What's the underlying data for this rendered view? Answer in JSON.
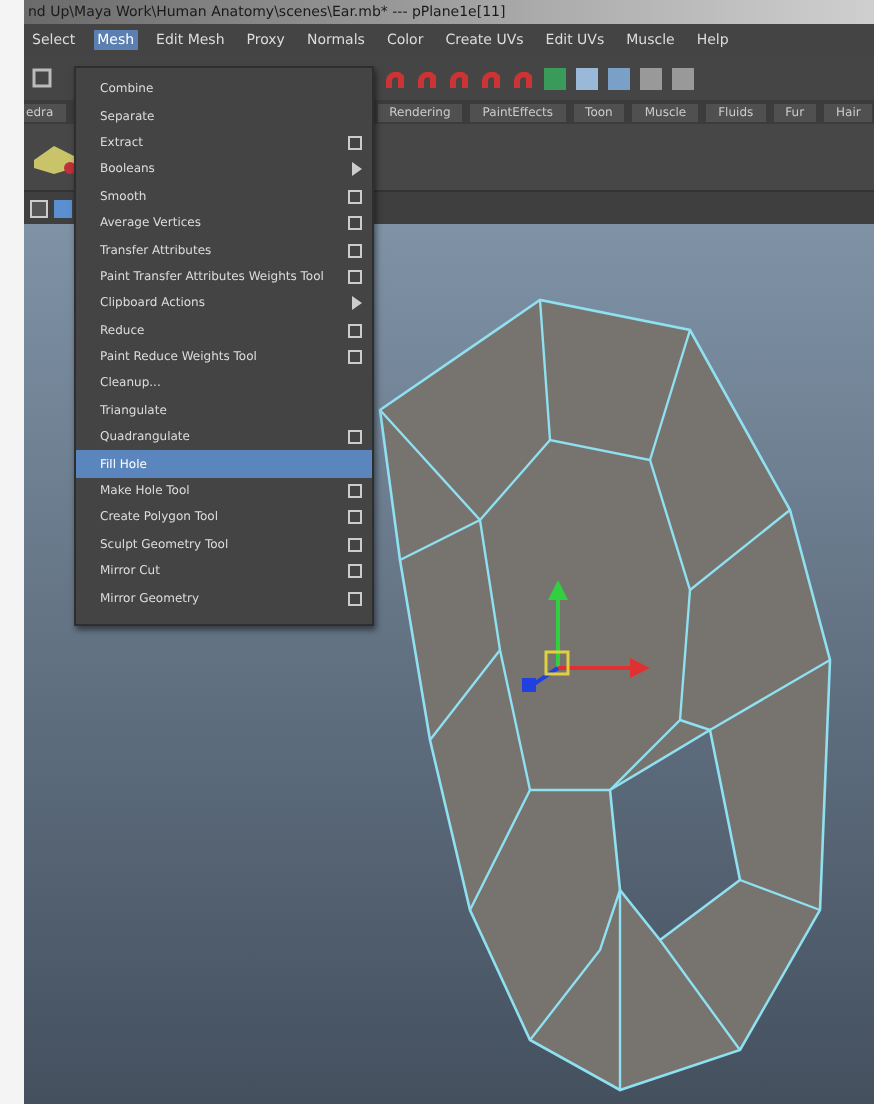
{
  "window": {
    "title": "nd Up\\Maya Work\\Human Anatomy\\scenes\\Ear.mb*  ---  pPlane1e[11]"
  },
  "menu_bar": [
    {
      "label": "Select",
      "selected": false
    },
    {
      "label": "Mesh",
      "selected": true
    },
    {
      "label": "Edit Mesh",
      "selected": false
    },
    {
      "label": "Proxy",
      "selected": false
    },
    {
      "label": "Normals",
      "selected": false
    },
    {
      "label": "Color",
      "selected": false
    },
    {
      "label": "Create UVs",
      "selected": false
    },
    {
      "label": "Edit UVs",
      "selected": false
    },
    {
      "label": "Muscle",
      "selected": false
    },
    {
      "label": "Help",
      "selected": false
    }
  ],
  "shelf_tabs": [
    {
      "label": "edra",
      "selected": false
    },
    {
      "label": "Rendering",
      "selected": false
    },
    {
      "label": "PaintEffects",
      "selected": false
    },
    {
      "label": "Toon",
      "selected": false
    },
    {
      "label": "Muscle",
      "selected": false
    },
    {
      "label": "Fluids",
      "selected": false
    },
    {
      "label": "Fur",
      "selected": false
    },
    {
      "label": "Hair",
      "selected": false
    }
  ],
  "mesh_menu": [
    {
      "label": "Combine",
      "kind": "plain",
      "selected": false
    },
    {
      "label": "Separate",
      "kind": "plain",
      "selected": false
    },
    {
      "label": "Extract",
      "kind": "option",
      "selected": false
    },
    {
      "label": "Booleans",
      "kind": "submenu",
      "selected": false
    },
    {
      "label": "Smooth",
      "kind": "option",
      "selected": false
    },
    {
      "label": "Average Vertices",
      "kind": "option",
      "selected": false
    },
    {
      "label": "Transfer Attributes",
      "kind": "option",
      "selected": false
    },
    {
      "label": "Paint Transfer Attributes Weights Tool",
      "kind": "option",
      "selected": false
    },
    {
      "label": "Clipboard Actions",
      "kind": "submenu",
      "selected": false
    },
    {
      "label": "Reduce",
      "kind": "option",
      "selected": false
    },
    {
      "label": "Paint Reduce Weights Tool",
      "kind": "option",
      "selected": false
    },
    {
      "label": "Cleanup...",
      "kind": "plain",
      "selected": false
    },
    {
      "label": "Triangulate",
      "kind": "plain",
      "selected": false
    },
    {
      "label": "Quadrangulate",
      "kind": "option",
      "selected": false
    },
    {
      "label": "Fill Hole",
      "kind": "plain",
      "selected": true
    },
    {
      "label": "Make Hole Tool",
      "kind": "option",
      "selected": false
    },
    {
      "label": "Create Polygon Tool",
      "kind": "option",
      "selected": false
    },
    {
      "label": "Sculpt Geometry Tool",
      "kind": "option",
      "selected": false
    },
    {
      "label": "Mirror Cut",
      "kind": "option",
      "selected": false
    },
    {
      "label": "Mirror Geometry",
      "kind": "option",
      "selected": false
    }
  ]
}
